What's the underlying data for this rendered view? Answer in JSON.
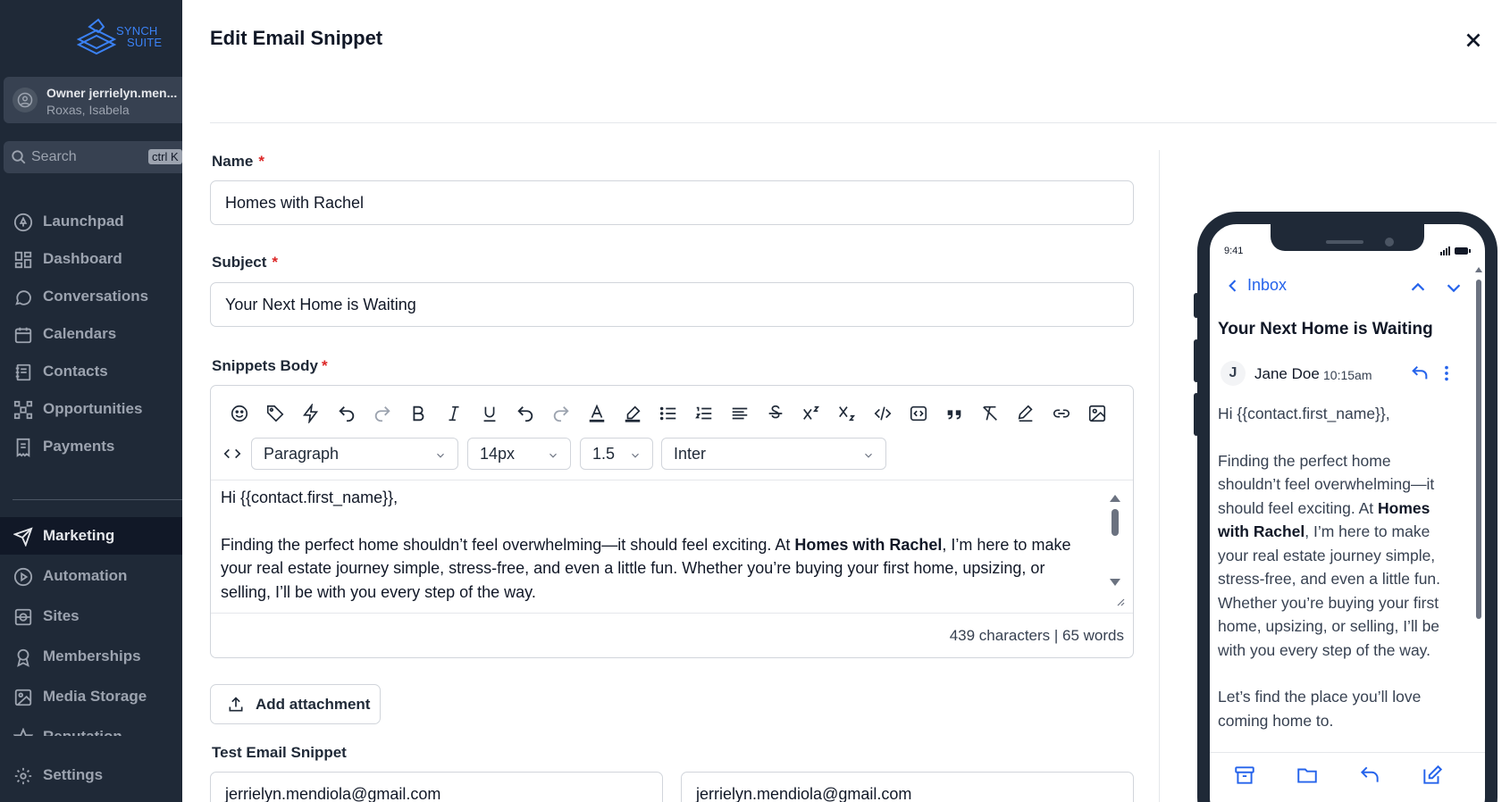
{
  "brand": {
    "logo_line1": "SYNCH",
    "logo_line2": "SUITE",
    "accent": "#3b82f6"
  },
  "account": {
    "role_email": "Owner jerrielyn.men...",
    "name": "Roxas, Isabela"
  },
  "sidebar_search": {
    "placeholder": "Search",
    "shortcut": "ctrl K"
  },
  "nav": {
    "items": [
      {
        "label": "Launchpad",
        "icon": "rocket-icon"
      },
      {
        "label": "Dashboard",
        "icon": "grid-icon"
      },
      {
        "label": "Conversations",
        "icon": "chat-bubble-icon"
      },
      {
        "label": "Calendars",
        "icon": "calendar-icon"
      },
      {
        "label": "Contacts",
        "icon": "contact-book-icon"
      },
      {
        "label": "Opportunities",
        "icon": "hub-icon"
      },
      {
        "label": "Payments",
        "icon": "receipt-icon"
      },
      {
        "label": "Marketing",
        "icon": "send-icon",
        "active": true
      },
      {
        "label": "Automation",
        "icon": "play-circle-icon"
      },
      {
        "label": "Sites",
        "icon": "globe-icon"
      },
      {
        "label": "Memberships",
        "icon": "badge-icon"
      },
      {
        "label": "Media Storage",
        "icon": "image-icon"
      },
      {
        "label": "Reputation",
        "icon": "star-icon"
      },
      {
        "label": "Settings",
        "icon": "gear-icon"
      }
    ]
  },
  "dialog": {
    "title": "Edit Email Snippet",
    "name_label": "Name",
    "name_value": "Homes with Rachel",
    "subject_label": "Subject",
    "subject_value": "Your Next Home is Waiting",
    "body_label": "Snippets Body",
    "required_mark": "*"
  },
  "editor": {
    "block_format": "Paragraph",
    "font_size": "14px",
    "line_height": "1.5",
    "font_family": "Inter",
    "greeting": "Hi {{contact.first_name}},",
    "para1_before": "Finding the perfect home shouldn’t feel overwhelming—it should feel exciting. At ",
    "para1_bold": "Homes with Rachel",
    "para1_line1_after": ", I’m here to make",
    "para1_line2": "your real estate journey simple, stress-free, and even a little fun. Whether you’re buying your first home, upsizing, or",
    "para1_line3": "selling, I’ll be with you every step of the way.",
    "counts": "439 characters | 65 words"
  },
  "attachment": {
    "label": "Add attachment"
  },
  "test": {
    "label": "Test Email Snippet",
    "from_email": "jerrielyn.mendiola@gmail.com",
    "to_email": "jerrielyn.mendiola@gmail.com"
  },
  "preview": {
    "time": "9:41",
    "back_label": "Inbox",
    "subject": "Your Next Home is Waiting",
    "sender_initial": "J",
    "sender": "Jane Doe",
    "sent_time": "10:15am",
    "greeting": "Hi {{contact.first_name}},",
    "p1_l1": "Finding the perfect home",
    "p1_l2": "shouldn’t feel overwhelming—it",
    "p1_l3_before": "should feel exciting. At ",
    "p1_l3_bold": "Homes",
    "p1_l4_bold": "with Rachel",
    "p1_l4_after": ", I’m here to make",
    "p1_l5": "your real estate journey simple,",
    "p1_l6": "stress-free, and even a little fun.",
    "p1_l7": "Whether you’re buying your first",
    "p1_l8": "home, upsizing, or selling, I’ll be",
    "p1_l9": "with you every step of the way.",
    "p2_l1": "Let’s find the place you’ll love",
    "p2_l2": "coming home to."
  }
}
